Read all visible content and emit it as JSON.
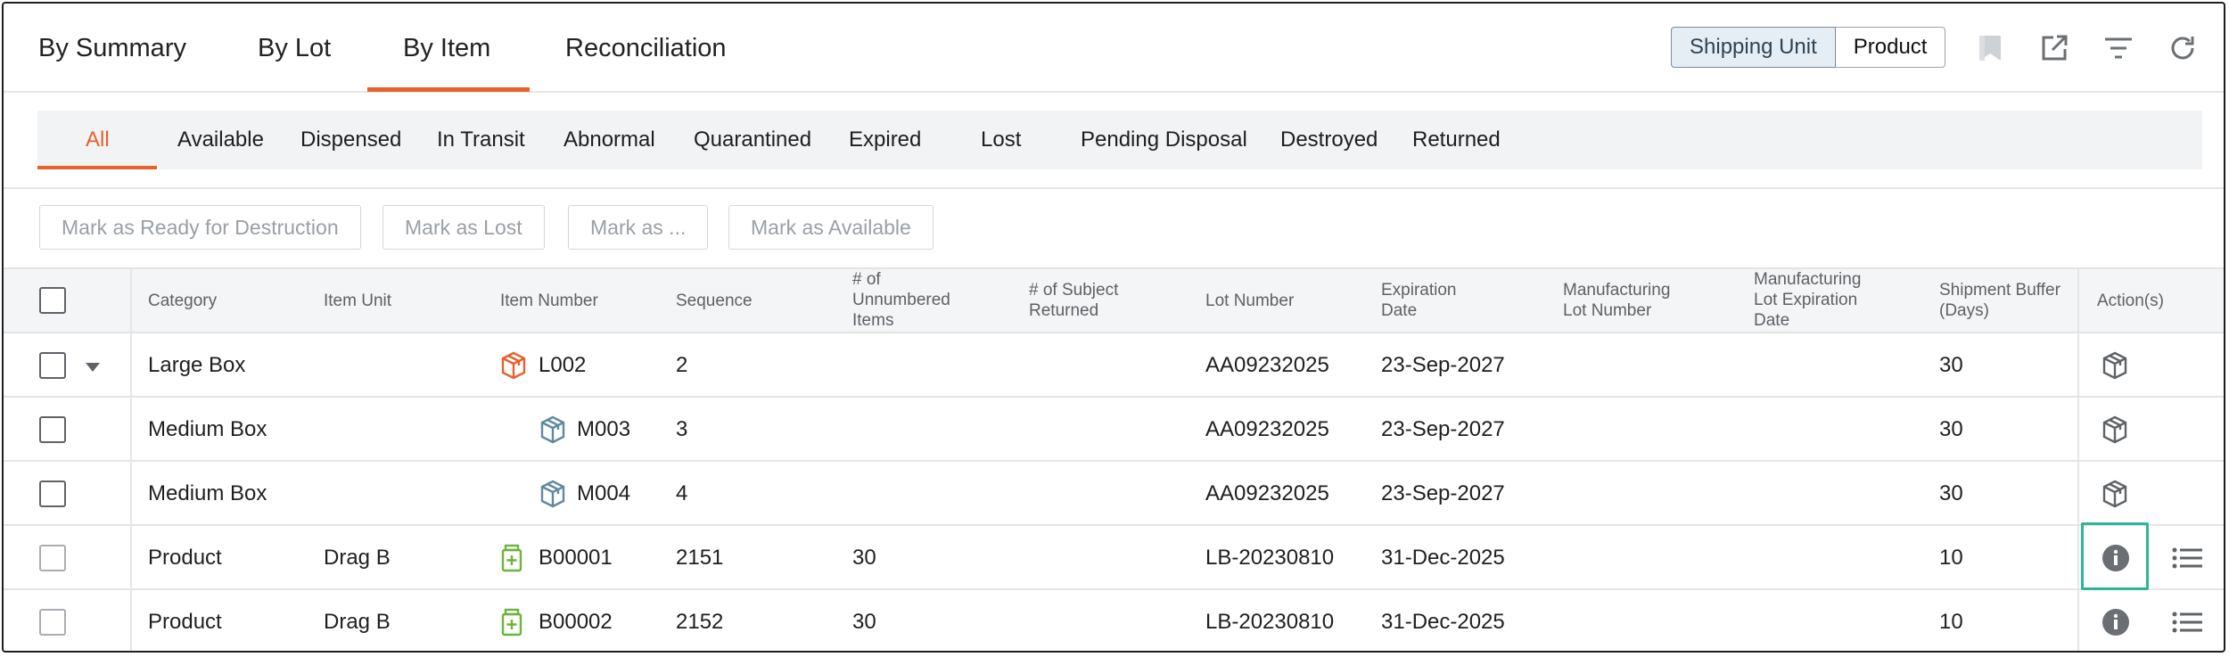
{
  "top_tabs": [
    "By Summary",
    "By Lot",
    "By Item",
    "Reconciliation"
  ],
  "active_top_tab": "By Item",
  "view_toggle": {
    "options": [
      "Shipping Unit",
      "Product"
    ],
    "selected": "Shipping Unit"
  },
  "toolbar_icons": [
    "bookmark-icon",
    "external-link-icon",
    "filter-icon",
    "refresh-icon"
  ],
  "status_tabs": [
    "All",
    "Available",
    "Dispensed",
    "In Transit",
    "Abnormal",
    "Quarantined",
    "Expired",
    "Lost",
    "Pending Disposal",
    "Destroyed",
    "Returned"
  ],
  "active_status_tab": "All",
  "actions": [
    "Mark as Ready for Destruction",
    "Mark as Lost",
    "Mark as ...",
    "Mark as Available"
  ],
  "columns": {
    "category": "Category",
    "item_unit": "Item Unit",
    "item_number": "Item Number",
    "sequence": "Sequence",
    "unnumbered": [
      "# of",
      "Unnumbered",
      "Items"
    ],
    "subject_returned": [
      "# of Subject",
      "Returned"
    ],
    "lot_number": "Lot Number",
    "expiration": [
      "Expiration",
      "Date"
    ],
    "mfg_lot": [
      "Manufacturing",
      "Lot Number"
    ],
    "mfg_lot_exp": [
      "Manufacturing",
      "Lot Expiration",
      "Date"
    ],
    "shipment_buffer": [
      "Shipment Buffer",
      "(Days)"
    ],
    "actions": "Action(s)"
  },
  "rows": [
    {
      "category": "Large Box",
      "item_unit": "",
      "item_number": "L002",
      "sequence": "2",
      "unnumbered": "",
      "subject_returned": "",
      "lot_number": "AA09232025",
      "expiration": "23-Sep-2027",
      "mfg_lot": "",
      "mfg_lot_exp": "",
      "shipment_buffer": "30",
      "item_icon": "box-icon",
      "action_icon": "package-icon"
    },
    {
      "category": "Medium Box",
      "item_unit": "",
      "item_number": "M003",
      "sequence": "3",
      "unnumbered": "",
      "subject_returned": "",
      "lot_number": "AA09232025",
      "expiration": "23-Sep-2027",
      "mfg_lot": "",
      "mfg_lot_exp": "",
      "shipment_buffer": "30",
      "item_icon": "cube-icon",
      "action_icon": "package-icon"
    },
    {
      "category": "Medium Box",
      "item_unit": "",
      "item_number": "M004",
      "sequence": "4",
      "unnumbered": "",
      "subject_returned": "",
      "lot_number": "AA09232025",
      "expiration": "23-Sep-2027",
      "mfg_lot": "",
      "mfg_lot_exp": "",
      "shipment_buffer": "30",
      "item_icon": "cube-icon",
      "action_icon": "package-icon"
    },
    {
      "category": "Product",
      "item_unit": "Drag B",
      "item_number": "B00001",
      "sequence": "2151",
      "unnumbered": "30",
      "subject_returned": "",
      "lot_number": "LB-20230810",
      "expiration": "31-Dec-2025",
      "mfg_lot": "",
      "mfg_lot_exp": "",
      "shipment_buffer": "10",
      "item_icon": "medicine-bottle-icon",
      "action_icon": "info-icon"
    },
    {
      "category": "Product",
      "item_unit": "Drag B",
      "item_number": "B00002",
      "sequence": "2152",
      "unnumbered": "30",
      "subject_returned": "",
      "lot_number": "LB-20230810",
      "expiration": "31-Dec-2025",
      "mfg_lot": "",
      "mfg_lot_exp": "",
      "shipment_buffer": "10",
      "item_icon": "medicine-bottle-icon",
      "action_icon": "info-icon"
    }
  ],
  "colors": {
    "accent": "#e8612c",
    "highlight": "#2bb59a",
    "product_icon": "#6cb33f",
    "box_icon": "#5e8aa0"
  }
}
